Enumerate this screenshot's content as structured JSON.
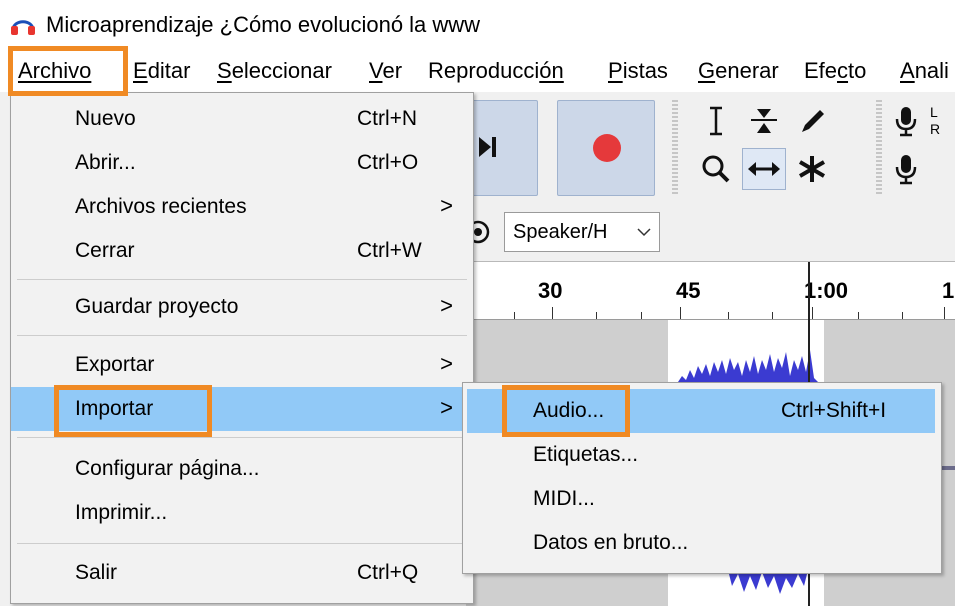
{
  "window": {
    "title": "Microaprendizaje ¿Cómo evolucionó la www",
    "icon": "headphones-icon"
  },
  "menubar": {
    "archivo": "Archivo",
    "editar_u": "E",
    "editar_rest": "ditar",
    "seleccionar_u": "S",
    "seleccionar_rest": "eleccionar",
    "ver_u": "V",
    "ver_rest": "er",
    "reproduccion_a": "Reproducci",
    "reproduccion_u": "ó",
    "reproduccion_b": "n",
    "pistas_u": "P",
    "pistas_rest": "istas",
    "generar_u": "G",
    "generar_rest": "enerar",
    "efecto_a": "Efe",
    "efecto_u": "c",
    "efecto_b": "to",
    "analizar_u": "A",
    "analizar_rest": "nali"
  },
  "archivo_menu": {
    "items": [
      {
        "label": "Nuevo",
        "shortcut": "Ctrl+N"
      },
      {
        "label": "Abrir...",
        "shortcut": "Ctrl+O"
      },
      {
        "label": "Archivos recientes",
        "shortcut": ""
      },
      {
        "label": "Cerrar",
        "shortcut": "Ctrl+W"
      },
      {
        "label": "Guardar proyecto",
        "shortcut": ""
      },
      {
        "label": "Exportar",
        "shortcut": ""
      },
      {
        "label": "Importar",
        "shortcut": ""
      },
      {
        "label": "Configurar página...",
        "shortcut": ""
      },
      {
        "label": "Imprimir...",
        "shortcut": ""
      },
      {
        "label": "Salir",
        "shortcut": "Ctrl+Q"
      }
    ],
    "submenu_arrow": ">"
  },
  "importar_submenu": {
    "items": [
      {
        "label": "Audio...",
        "shortcut": "Ctrl+Shift+I"
      },
      {
        "label": "Etiquetas...",
        "shortcut": ""
      },
      {
        "label": "MIDI...",
        "shortcut": ""
      },
      {
        "label": "Datos en bruto...",
        "shortcut": ""
      }
    ]
  },
  "toolbar": {
    "playback_device": "Speaker/H",
    "meter_l": "L",
    "meter_r": "R"
  },
  "ruler": {
    "labels": [
      "30",
      "45",
      "1:00",
      "1"
    ]
  },
  "colors": {
    "highlight": "#91c9f7",
    "annotation_box": "#f08a24",
    "record": "#e5393b",
    "waveform": "#3b3bd1"
  }
}
